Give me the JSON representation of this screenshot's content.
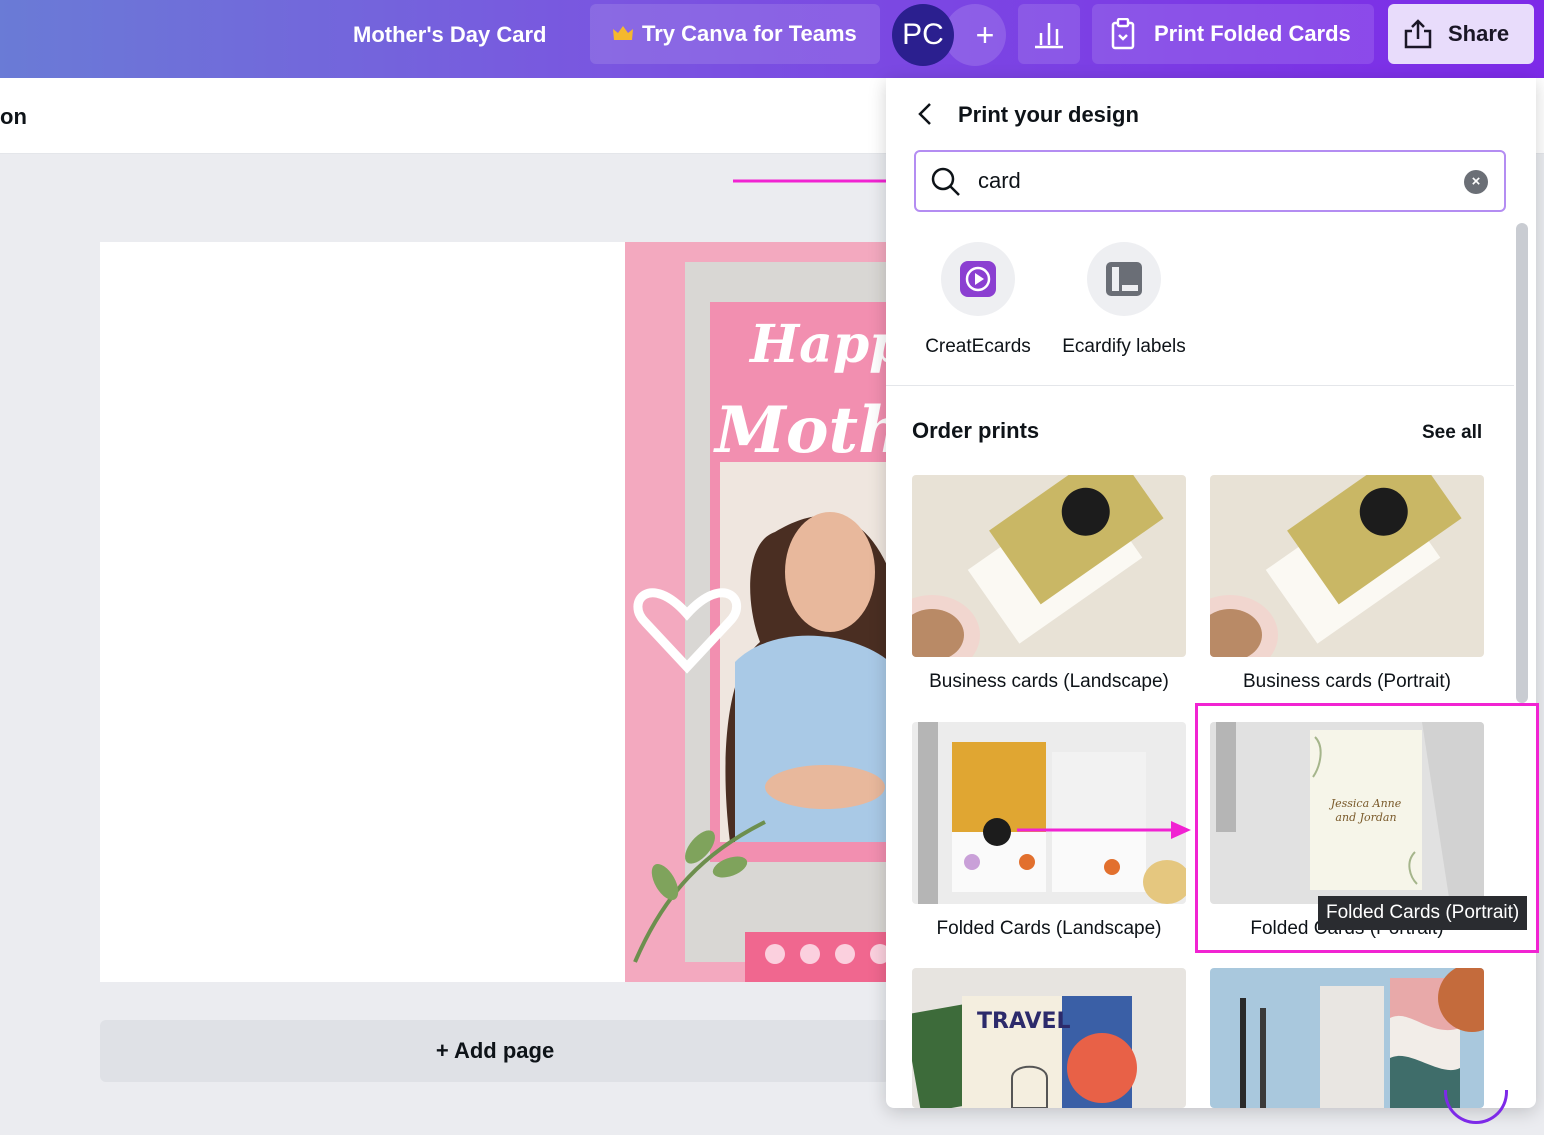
{
  "topbar": {
    "design_title": "Mother's Day Card",
    "teams_label": "Try Canva for Teams",
    "avatar_initials": "PC",
    "add_member": "+",
    "print_label": "Print Folded Cards",
    "share_label": "Share"
  },
  "editor": {
    "toolbar_text": "on",
    "add_page_label": "+ Add page"
  },
  "panel": {
    "title": "Print your design",
    "search": {
      "value": "card"
    },
    "apps": [
      {
        "label": "CreatEcards",
        "icon": "createcards-icon",
        "color": "#8b3fd1"
      },
      {
        "label": "Ecardify labels",
        "icon": "ecardify-icon",
        "color": "#6a6e76"
      }
    ],
    "section_title": "Order prints",
    "see_all": "See all",
    "products": [
      {
        "label": "Business cards (Landscape)"
      },
      {
        "label": "Business cards (Portrait)"
      },
      {
        "label": "Folded Cards (Landscape)"
      },
      {
        "label": "Folded Cards (Portrait)"
      },
      {
        "label": ""
      },
      {
        "label": ""
      }
    ]
  },
  "tooltip": "Folded Cards (Portrait)",
  "colors": {
    "accent": "#7d2ae8",
    "annotation": "#f123d2"
  }
}
